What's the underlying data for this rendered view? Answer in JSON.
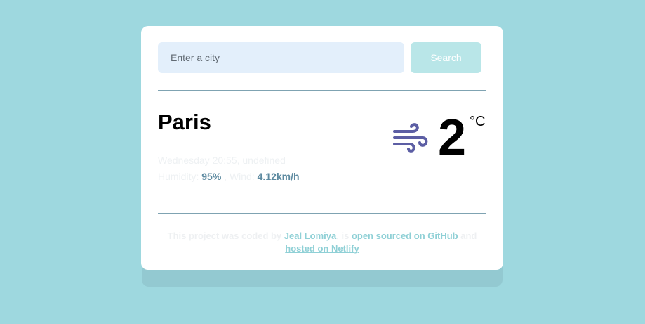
{
  "search": {
    "placeholder": "Enter a city",
    "button_label": "Search"
  },
  "weather": {
    "city": "Paris",
    "datetime": "Wednesday 20:55, undefined",
    "humidity_label": "Humidity:",
    "humidity_value": "95%",
    "wind_label": ", Wind:",
    "wind_value": "4.12km/h",
    "temperature": "2",
    "unit": "°C",
    "icon": "wind-icon",
    "icon_color": "#5c5ea4"
  },
  "footer": {
    "text_1": "This project was coded by",
    "author_link": "Jeal Lomiya",
    "text_2": ", is",
    "github_link": "open sourced on GitHub",
    "text_3": "and",
    "netlify_link": "hosted on Netlify"
  },
  "colors": {
    "background": "#9ed8df",
    "card": "#ffffff",
    "input_bg": "#e3effb",
    "button_bg": "#b9e6e8",
    "link": "#8fd0d6"
  }
}
